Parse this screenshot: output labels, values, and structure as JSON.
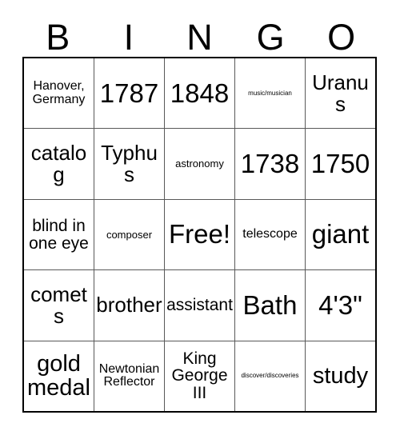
{
  "card": {
    "title_letters": [
      "B",
      "I",
      "N",
      "G",
      "O"
    ],
    "columns": 5,
    "rows": 5,
    "free_space_label": "Free!",
    "colors": {
      "background": "#ffffff",
      "text": "#000000",
      "outer_border": "#000000",
      "inner_gridline": "#595959"
    },
    "cells": [
      [
        {
          "text": "Hanover, Germany",
          "size": "sm"
        },
        {
          "text": "1787",
          "size": "xxl"
        },
        {
          "text": "1848",
          "size": "xxl"
        },
        {
          "text": "music/musician",
          "size": "xxs"
        },
        {
          "text": "Uranus",
          "size": "lg"
        }
      ],
      [
        {
          "text": "catalog",
          "size": "lg"
        },
        {
          "text": "Typhus",
          "size": "lg"
        },
        {
          "text": "astronomy",
          "size": "xs"
        },
        {
          "text": "1738",
          "size": "xxl"
        },
        {
          "text": "1750",
          "size": "xxl"
        }
      ],
      [
        {
          "text": "blind in one eye",
          "size": "md"
        },
        {
          "text": "composer",
          "size": "xs"
        },
        {
          "text": "Free!",
          "size": "xxl"
        },
        {
          "text": "telescope",
          "size": "sm"
        },
        {
          "text": "giant",
          "size": "xxl"
        }
      ],
      [
        {
          "text": "comets",
          "size": "lg"
        },
        {
          "text": "brother",
          "size": "lg"
        },
        {
          "text": "assistant",
          "size": "md"
        },
        {
          "text": "Bath",
          "size": "xxl"
        },
        {
          "text": "4'3\"",
          "size": "xxl"
        }
      ],
      [
        {
          "text": "gold medal",
          "size": "xl"
        },
        {
          "text": "Newtonian Reflector",
          "size": "sm"
        },
        {
          "text": "King George III",
          "size": "md"
        },
        {
          "text": "discover/discoveries",
          "size": "xxs"
        },
        {
          "text": "study",
          "size": "xl"
        }
      ]
    ]
  }
}
